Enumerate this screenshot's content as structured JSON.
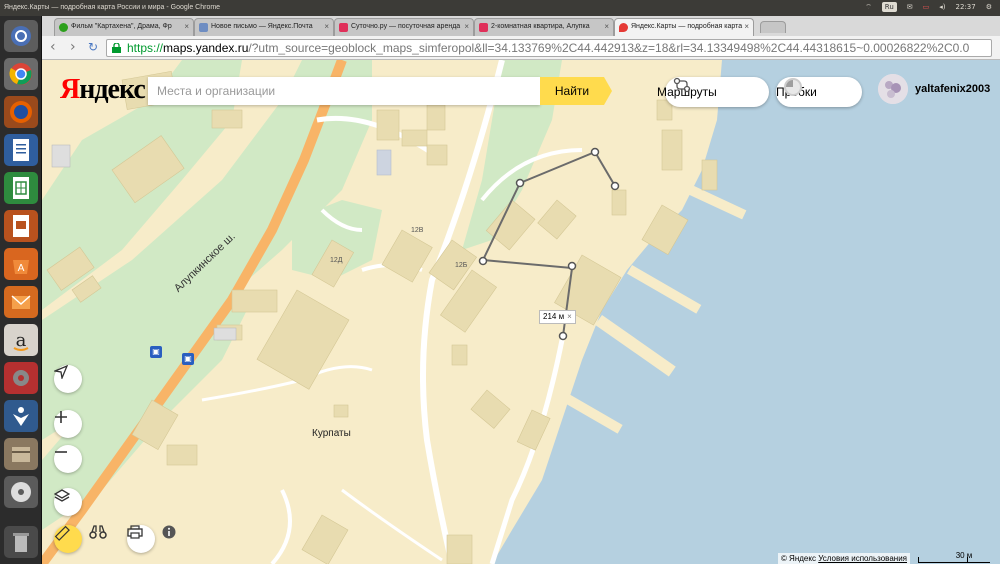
{
  "system": {
    "window_title": "Яндекс.Карты — подробная карта России и мира - Google Chrome",
    "lang": "Ru",
    "time": "22:37"
  },
  "tabs": [
    {
      "label": "Фильм \"Картахена\", Драма, Фр",
      "active": false,
      "fav": "#2ca01c"
    },
    {
      "label": "Новое письмо — Яндекс.Почта",
      "active": false,
      "fav": "#6e8dc2"
    },
    {
      "label": "Суточно.ру — посуточная аренда",
      "active": false,
      "fav": "#e0305a"
    },
    {
      "label": "2-комнатная квартира, Алупка",
      "active": false,
      "fav": "#e0305a"
    },
    {
      "label": "Яндекс.Карты — подробная карта",
      "active": true,
      "fav": "#e53935"
    }
  ],
  "url": {
    "scheme": "https://",
    "host": "maps.yandex.ru",
    "path": "/?utm_source=geoblock_maps_simferopol&ll=34.133769%2C44.442913&z=18&rl=34.13349498%2C44.44318615~0.00026822%2C0.0"
  },
  "header": {
    "logo_y": "Я",
    "logo_rest": "ндекс",
    "search_placeholder": "Места и организации",
    "find_label": "Найти",
    "routes_label": "Маршруты",
    "traffic_label": "Пробки",
    "username": "yaltafenix2003"
  },
  "map": {
    "street_name": "Алупкинское ш.",
    "place_name": "Курпаты",
    "building_labels": [
      "12В",
      "12Д",
      "12Б"
    ],
    "distance": "214 м",
    "scale": "30 м",
    "copyright": "© Яндекс",
    "terms": "Условия использования",
    "colors": {
      "land": "#f7ecc9",
      "water": "#b5d0e0",
      "green": "#d1e9c5",
      "building": "#e8dcb0",
      "highway": "#f8b467"
    }
  }
}
